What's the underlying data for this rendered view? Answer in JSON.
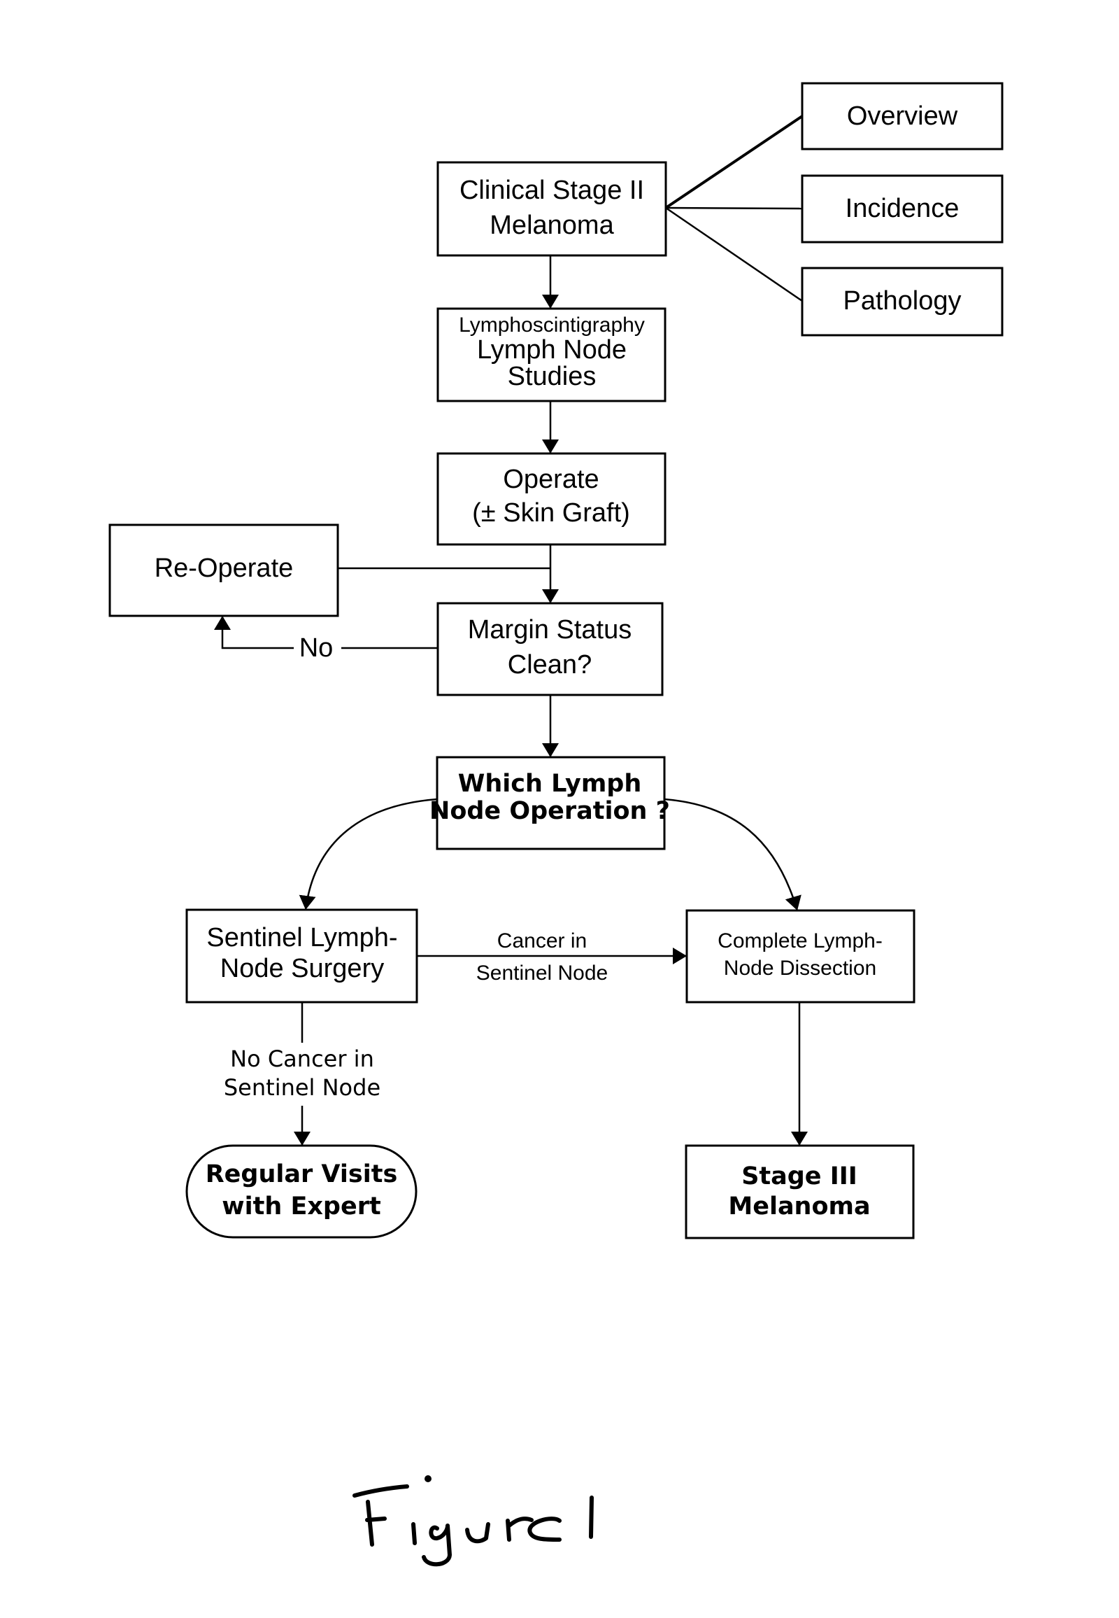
{
  "diagram": {
    "type": "flowchart",
    "nodes": {
      "clinical_stage": {
        "lines": [
          "Clinical Stage II",
          "Melanoma"
        ]
      },
      "overview": {
        "lines": [
          "Overview"
        ]
      },
      "incidence": {
        "lines": [
          "Incidence"
        ]
      },
      "pathology": {
        "lines": [
          "Pathology"
        ]
      },
      "lymphoscintigraphy": {
        "lines": [
          "Lymphoscintigraphy",
          "Lymph Node",
          "Studies"
        ]
      },
      "operate": {
        "lines": [
          "Operate",
          "(± Skin Graft)"
        ]
      },
      "re_operate": {
        "lines": [
          "Re-Operate"
        ]
      },
      "margin_status": {
        "lines": [
          "Margin Status",
          "Clean?"
        ]
      },
      "which_operation": {
        "lines": [
          "Which Lymph",
          "Node Operation ?"
        ]
      },
      "sentinel_surgery": {
        "lines": [
          "Sentinel Lymph-",
          "Node Surgery"
        ]
      },
      "complete_dissection": {
        "lines": [
          "Complete Lymph-",
          "Node Dissection"
        ]
      },
      "regular_visits": {
        "lines": [
          "Regular Visits",
          "with Expert"
        ]
      },
      "stage_three": {
        "lines": [
          "Stage III",
          "Melanoma"
        ]
      }
    },
    "edge_labels": {
      "no": "No",
      "cancer_in_node": [
        "Cancer in",
        "Sentinel Node"
      ],
      "no_cancer_in_node": [
        "No Cancer in",
        "Sentinel Node"
      ]
    },
    "edges": [
      {
        "from": "clinical_stage",
        "to": "overview",
        "arrow": false
      },
      {
        "from": "clinical_stage",
        "to": "incidence",
        "arrow": false
      },
      {
        "from": "clinical_stage",
        "to": "pathology",
        "arrow": false
      },
      {
        "from": "clinical_stage",
        "to": "lymphoscintigraphy",
        "arrow": true
      },
      {
        "from": "lymphoscintigraphy",
        "to": "operate",
        "arrow": true
      },
      {
        "from": "operate",
        "to": "margin_status",
        "arrow": true
      },
      {
        "from": "re_operate",
        "to": "margin_status",
        "arrow": true
      },
      {
        "from": "margin_status",
        "to": "re_operate",
        "arrow": true,
        "label": "No"
      },
      {
        "from": "margin_status",
        "to": "which_operation",
        "arrow": true
      },
      {
        "from": "which_operation",
        "to": "sentinel_surgery",
        "arrow": true
      },
      {
        "from": "which_operation",
        "to": "complete_dissection",
        "arrow": true
      },
      {
        "from": "sentinel_surgery",
        "to": "complete_dissection",
        "arrow": true,
        "label": "Cancer in Sentinel Node"
      },
      {
        "from": "sentinel_surgery",
        "to": "regular_visits",
        "arrow": true,
        "label": "No Cancer in Sentinel Node"
      },
      {
        "from": "complete_dissection",
        "to": "stage_three",
        "arrow": true
      }
    ]
  },
  "caption": "Figure 1"
}
